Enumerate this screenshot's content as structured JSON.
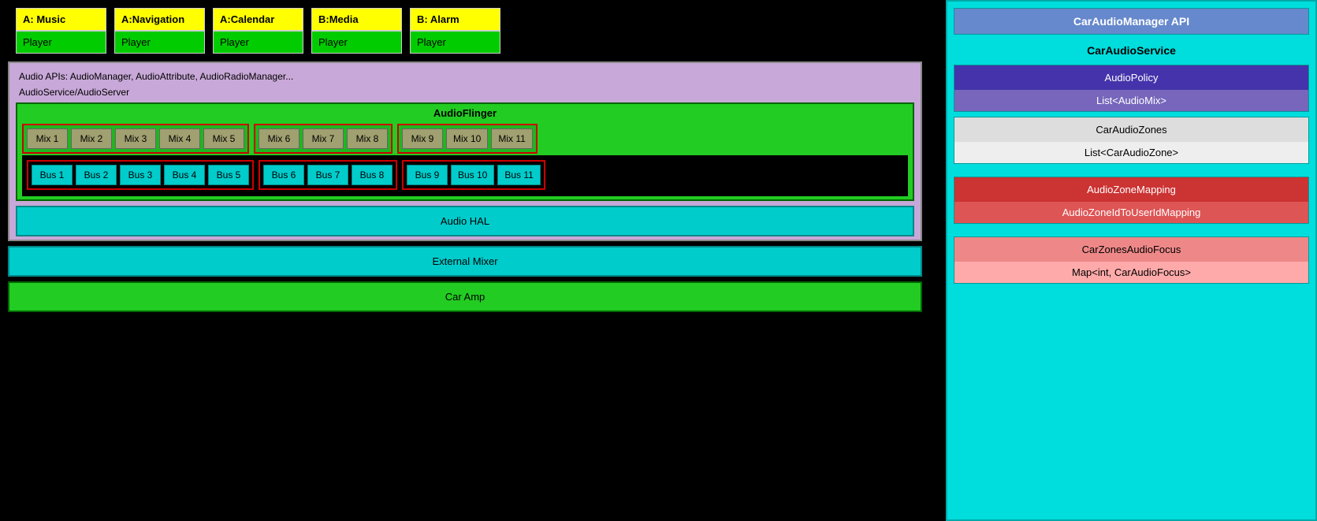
{
  "players": [
    {
      "label": "A: Music",
      "sub": "Player"
    },
    {
      "label": "A:Navigation",
      "sub": "Player"
    },
    {
      "label": "A:Calendar",
      "sub": "Player"
    },
    {
      "label": "B:Media",
      "sub": "Player"
    },
    {
      "label": "B: Alarm",
      "sub": "Player"
    }
  ],
  "apis_text": "Audio APIs: AudioManager, AudioAttribute, AudioRadioManager...",
  "audioservice_text": "AudioService/AudioServer",
  "audioflinger_label": "AudioFlinger",
  "mix_groups": [
    {
      "items": [
        "Mix 1",
        "Mix 2",
        "Mix 3",
        "Mix 4",
        "Mix 5"
      ]
    },
    {
      "items": [
        "Mix 6",
        "Mix 7",
        "Mix 8"
      ]
    },
    {
      "items": [
        "Mix 9",
        "Mix 10",
        "Mix 11"
      ]
    }
  ],
  "bus_groups": [
    {
      "items": [
        "Bus 1",
        "Bus 2",
        "Bus 3",
        "Bus 4",
        "Bus 5"
      ]
    },
    {
      "items": [
        "Bus 6",
        "Bus 7",
        "Bus 8"
      ]
    },
    {
      "items": [
        "Bus 9",
        "Bus 10",
        "Bus 11"
      ]
    }
  ],
  "audio_hal_label": "Audio HAL",
  "external_mixer_label": "External Mixer",
  "car_amp_label": "Car Amp",
  "right_panel": {
    "car_audio_manager_api": "CarAudioManager API",
    "car_audio_service": "CarAudioService",
    "audio_policy": "AudioPolicy",
    "list_audio_mix": "List<AudioMix>",
    "car_audio_zones": "CarAudioZones",
    "list_car_audio_zone": "List<CarAudioZone>",
    "audio_zone_mapping": "AudioZoneMapping",
    "audio_zone_id_mapping": "AudioZoneIdToUserIdMapping",
    "car_zones_audio_focus": "CarZonesAudioFocus",
    "map_car_audio_focus": "Map<int, CarAudioFocus>"
  }
}
